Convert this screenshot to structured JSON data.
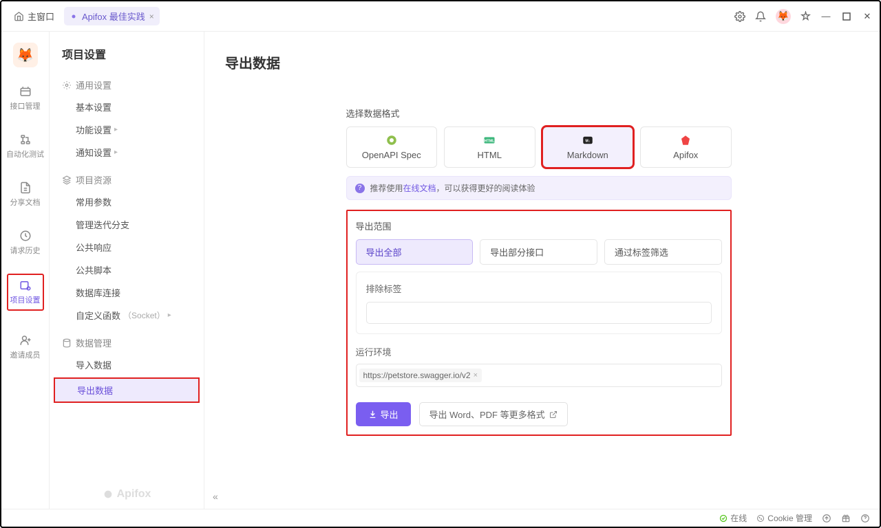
{
  "titlebar": {
    "main_window": "主窗口",
    "tab_label": "Apifox 最佳实践"
  },
  "leftnav": {
    "items": [
      {
        "label": "接口管理"
      },
      {
        "label": "自动化测试"
      },
      {
        "label": "分享文档"
      },
      {
        "label": "请求历史"
      },
      {
        "label": "项目设置"
      },
      {
        "label": "邀请成员"
      }
    ]
  },
  "sidepanel": {
    "title": "项目设置",
    "sections": [
      {
        "title": "通用设置",
        "items": [
          "基本设置",
          "功能设置",
          "通知设置"
        ]
      },
      {
        "title": "项目资源",
        "items": [
          "常用参数",
          "管理迭代分支",
          "公共响应",
          "公共脚本",
          "数据库连接",
          "自定义函数"
        ],
        "suffix5": "（Socket）"
      },
      {
        "title": "数据管理",
        "items": [
          "导入数据",
          "导出数据"
        ]
      }
    ],
    "brand": "Apifox"
  },
  "content": {
    "title": "导出数据",
    "format_label": "选择数据格式",
    "formats": [
      "OpenAPI Spec",
      "HTML",
      "Markdown",
      "Apifox"
    ],
    "tip_prefix": "推荐使用",
    "tip_link": "在线文档",
    "tip_suffix": "，可以获得更好的阅读体验",
    "scope_label": "导出范围",
    "scope_options": [
      "导出全部",
      "导出部分接口",
      "通过标签筛选"
    ],
    "exclude_label": "排除标签",
    "env_label": "运行环境",
    "env_tag": "https://petstore.swagger.io/v2",
    "export_btn": "导出",
    "export_more": "导出 Word、PDF 等更多格式"
  },
  "statusbar": {
    "online": "在线",
    "cookie": "Cookie 管理"
  }
}
